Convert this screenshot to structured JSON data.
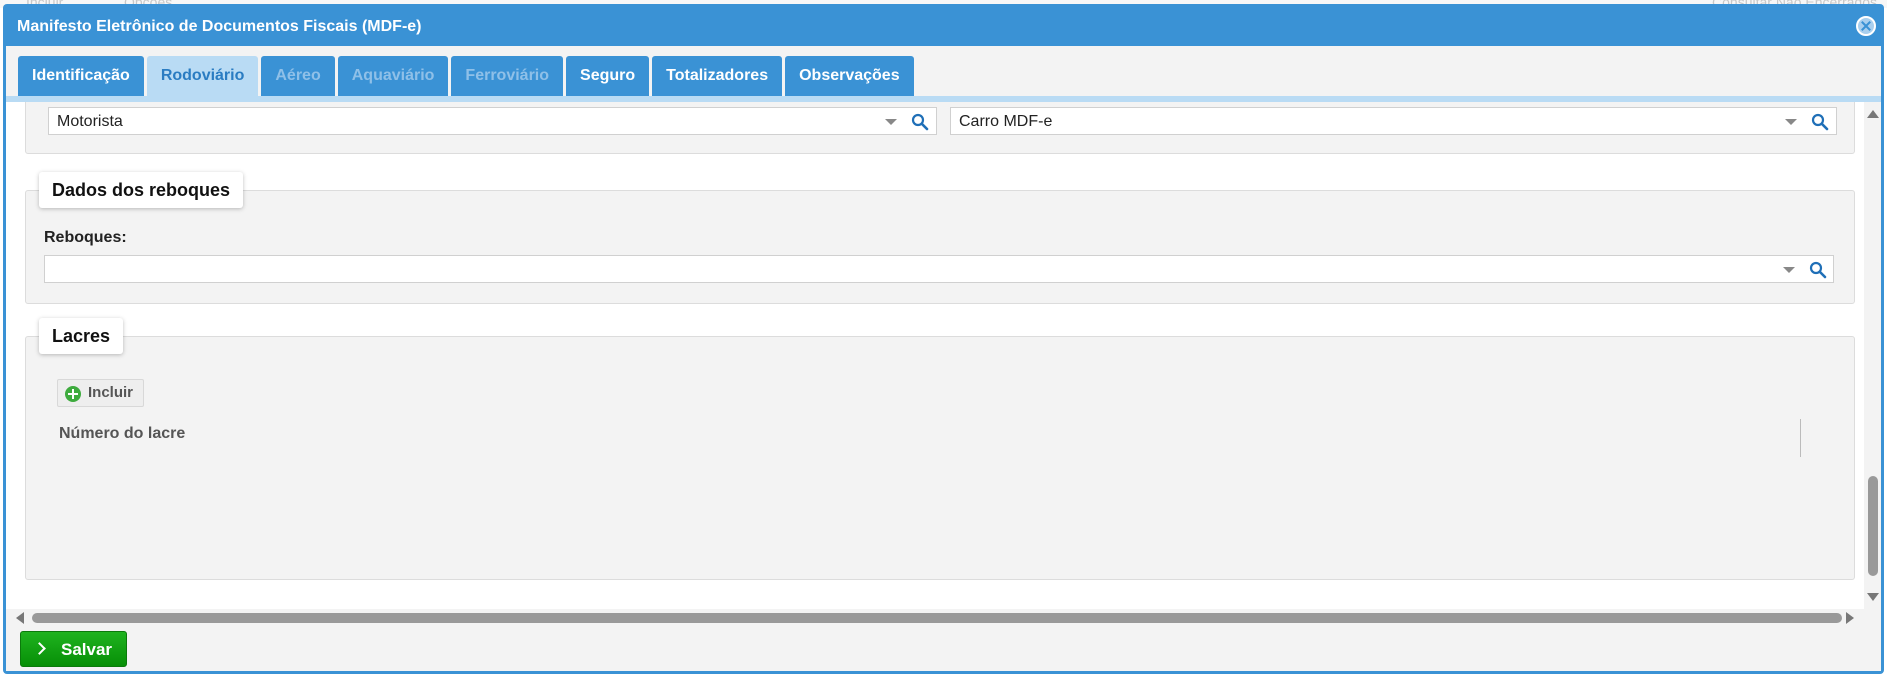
{
  "background": {
    "left_text_1": "Incluir",
    "left_text_2": "Opções",
    "right_text": "Consultar Não Encerrados"
  },
  "window": {
    "title": "Manifesto Eletrônico de Documentos Fiscais (MDF-e)"
  },
  "tabs": [
    {
      "label": "Identificação",
      "state": "normal"
    },
    {
      "label": "Rodoviário",
      "state": "active"
    },
    {
      "label": "Aéreo",
      "state": "disabled"
    },
    {
      "label": "Aquaviário",
      "state": "disabled"
    },
    {
      "label": "Ferroviário",
      "state": "disabled"
    },
    {
      "label": "Seguro",
      "state": "normal"
    },
    {
      "label": "Totalizadores",
      "state": "normal"
    },
    {
      "label": "Observações",
      "state": "normal"
    }
  ],
  "top_fields": {
    "motorista": "Motorista",
    "veiculo": "Carro MDF-e"
  },
  "reboques": {
    "section_title": "Dados dos reboques",
    "label": "Reboques:",
    "value": ""
  },
  "lacres": {
    "section_title": "Lacres",
    "add_button": "Incluir",
    "column_header": "Número do lacre"
  },
  "footer": {
    "save_label": "Salvar"
  },
  "colors": {
    "title_bar": "#3a92d5",
    "active_tab": "#b9dbf4",
    "save_button": "#13a313",
    "add_icon": "#3eab3e"
  }
}
